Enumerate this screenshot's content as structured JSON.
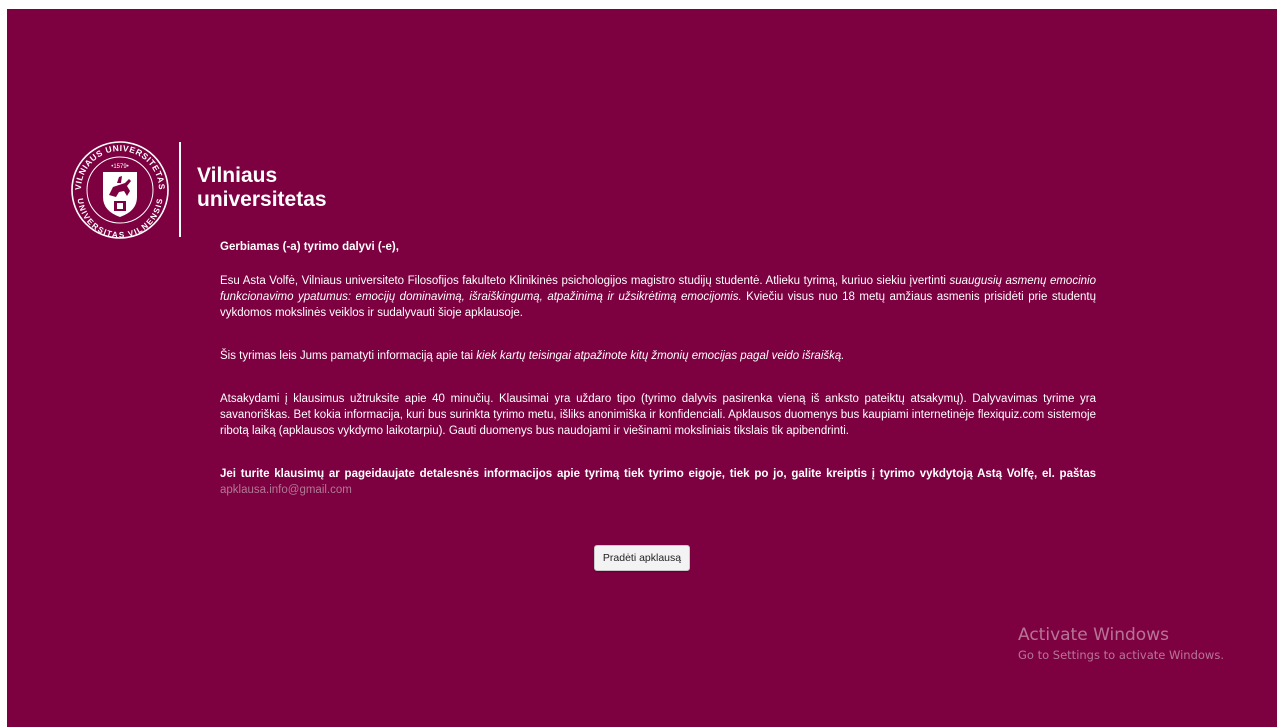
{
  "university": {
    "name_line1": "Vilniaus",
    "name_line2": "universitetas",
    "seal_top_text": "VILNIAUS UNIVERSITETAS",
    "seal_bottom_text": "UNIVERSITAS VILNENSIS",
    "seal_year": "•1579•"
  },
  "intro": {
    "greeting": "Gerbiamas (-a) tyrimo dalyvi (-e),",
    "p1_a": "Esu Asta Volfė, Vilniaus universiteto Filosofijos fakulteto Klinikinės psichologijos magistro studijų studentė. Atlieku tyrimą, kuriuo siekiu įvertinti ",
    "p1_em": "suaugusių asmenų emocinio funkcionavimo ypatumus: emocijų dominavimą, išraiškingumą, atpažinimą ir užsikrėtimą emocijomis.",
    "p1_b": " Kviečiu visus nuo 18 metų amžiaus asmenis prisidėti prie studentų vykdomos mokslinės veiklos ir sudalyvauti šioje apklausoje.",
    "p2_a": "Šis tyrimas leis Jums pamatyti informaciją apie tai ",
    "p2_em": "kiek kartų teisingai atpažinote kitų žmonių emocijas pagal veido išraišką.",
    "p3": "Atsakydami į klausimus užtruksite apie 40 minučių. Klausimai yra uždaro tipo (tyrimo dalyvis pasirenka vieną iš anksto pateiktų atsakymų). Dalyvavimas tyrime yra savanoriškas. Bet kokia informacija, kuri bus surinkta tyrimo metu, išliks anonimiška ir konfidenciali. Apklausos duomenys bus kaupiami internetinėje flexiquiz.com sistemoje ribotą laiką (apklausos vykdymo laikotarpiu). Gauti duomenys bus naudojami ir viešinami moksliniais tikslais tik apibendrinti.",
    "p4": "Jei turite klausimų ar pageidaujate detalesnės informacijos apie tyrimą tiek tyrimo eigoje, tiek po jo, galite kreiptis į tyrimo vykdytoją Astą Volfę, el. paštas",
    "email": "apklausa.info@gmail.com"
  },
  "start_button": {
    "label": "Pradėti apklausą"
  },
  "watermark": {
    "title": "Activate Windows",
    "subtitle": "Go to Settings to activate Windows."
  },
  "colors": {
    "background": "#7d0040",
    "text": "#ffffff",
    "email": "#b07a95"
  },
  "icons": {
    "logo": "university-seal-icon"
  }
}
